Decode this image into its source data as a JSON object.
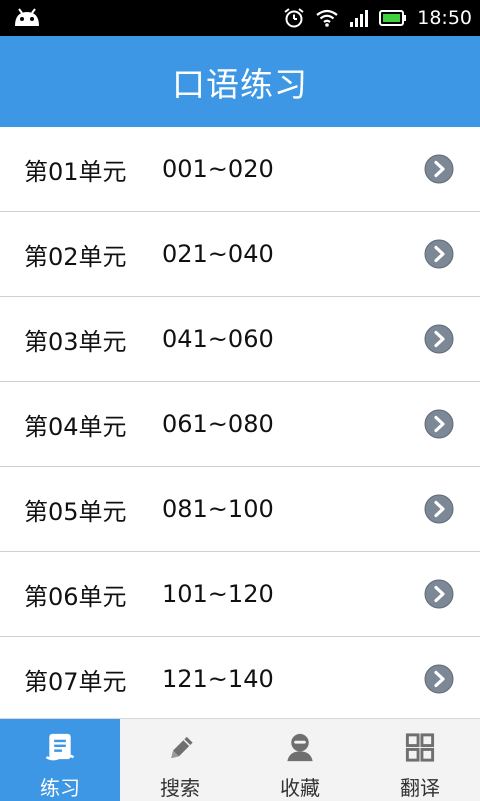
{
  "status_bar": {
    "time": "18:50"
  },
  "header": {
    "title": "口语练习"
  },
  "units": [
    {
      "unit": "第01单元",
      "range": "001~020"
    },
    {
      "unit": "第02单元",
      "range": "021~040"
    },
    {
      "unit": "第03单元",
      "range": "041~060"
    },
    {
      "unit": "第04单元",
      "range": "061~080"
    },
    {
      "unit": "第05单元",
      "range": "081~100"
    },
    {
      "unit": "第06单元",
      "range": "101~120"
    },
    {
      "unit": "第07单元",
      "range": "121~140"
    }
  ],
  "bottom_nav": {
    "tabs": [
      {
        "label": "练习",
        "icon": "practice-icon",
        "active": true
      },
      {
        "label": "搜索",
        "icon": "pencil-icon",
        "active": false
      },
      {
        "label": "收藏",
        "icon": "person-icon",
        "active": false
      },
      {
        "label": "翻译",
        "icon": "grid-icon",
        "active": false
      }
    ]
  },
  "colors": {
    "accent": "#3d97e4",
    "arrow": "#7d8897"
  }
}
